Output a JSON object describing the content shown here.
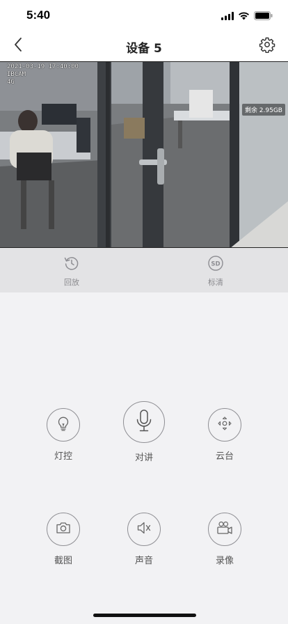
{
  "status": {
    "time": "5:40"
  },
  "nav": {
    "title": "设备 5"
  },
  "video": {
    "osd_lines": [
      "2021-03-19 17:40:00",
      "IBCAM",
      "4G"
    ],
    "storage_label": "剩余 2.95GB"
  },
  "quick_actions": [
    {
      "label": "回放",
      "icon": "history-icon"
    },
    {
      "label": "标清",
      "icon": "sd-quality-icon"
    }
  ],
  "controls": [
    {
      "label": "灯控",
      "icon": "bulb-icon"
    },
    {
      "label": "对讲",
      "icon": "microphone-icon"
    },
    {
      "label": "云台",
      "icon": "ptz-icon"
    },
    {
      "label": "截图",
      "icon": "camera-icon"
    },
    {
      "label": "声音",
      "icon": "speaker-mute-icon"
    },
    {
      "label": "录像",
      "icon": "video-record-icon"
    }
  ],
  "colors": {
    "background": "#f2f2f4",
    "quick_bar": "#e3e3e5",
    "icon_stroke": "#8e8e93"
  }
}
